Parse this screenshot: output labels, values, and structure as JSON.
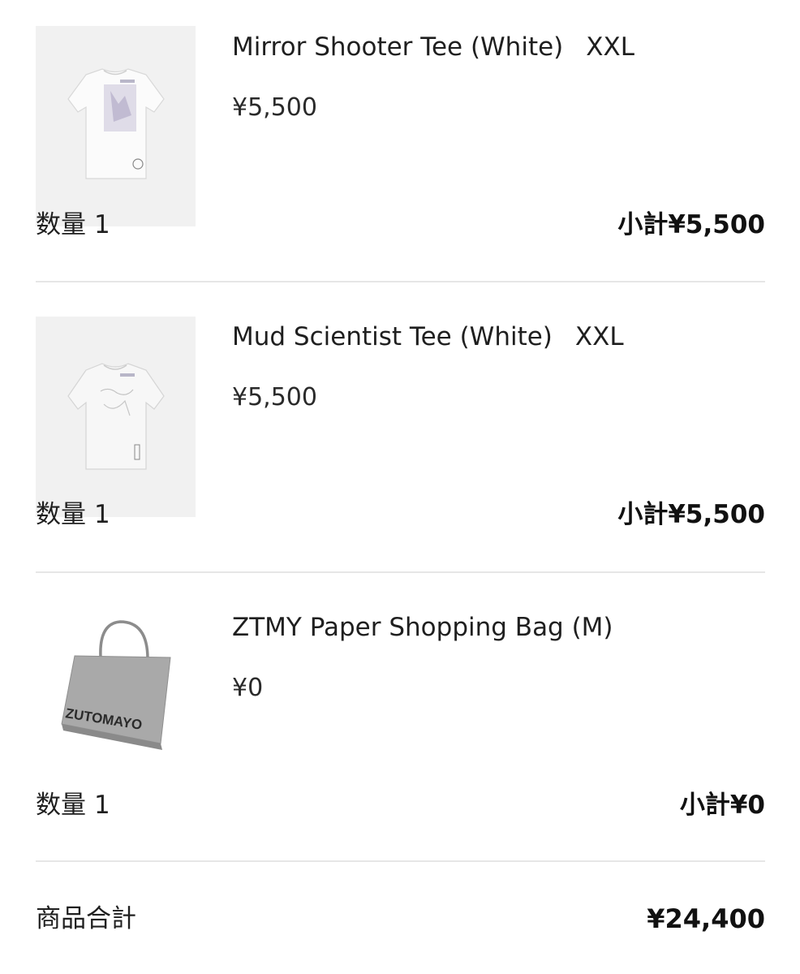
{
  "cart": {
    "items": [
      {
        "name": "Mirror Shooter Tee (White)",
        "size": "XXL",
        "price": "¥5,500",
        "qty_label": "数量",
        "qty": "1",
        "subtotal": "小計¥5,500",
        "image_icon": "tshirt-icon"
      },
      {
        "name": "Mud Scientist Tee (White)",
        "size": "XXL",
        "price": "¥5,500",
        "qty_label": "数量",
        "qty": "1",
        "subtotal": "小計¥5,500",
        "image_icon": "tshirt-icon"
      },
      {
        "name": "ZTMY Paper Shopping Bag (M)",
        "size": "",
        "price": "¥0",
        "qty_label": "数量",
        "qty": "1",
        "subtotal": "小計¥0",
        "image_icon": "shopping-bag-icon",
        "bag_brand_text": "ZUTOMAYO"
      }
    ],
    "total": {
      "label": "商品合計",
      "value": "¥24,400"
    }
  }
}
